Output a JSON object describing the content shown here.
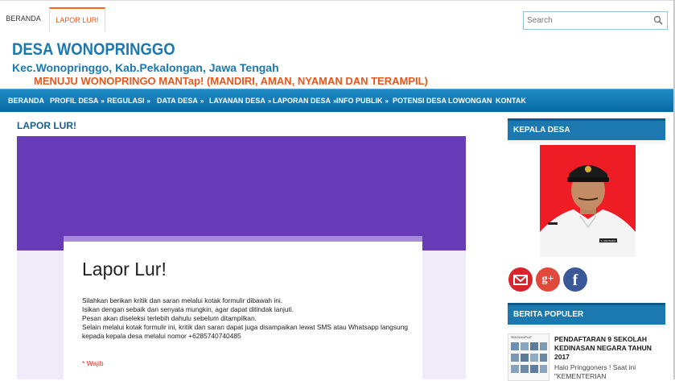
{
  "top_tabs": [
    {
      "label": "BERANDA"
    },
    {
      "label": "LAPOR LUR!"
    }
  ],
  "search": {
    "placeholder": "Search"
  },
  "site": {
    "title": "DESA WONOPRINGGO",
    "subtitle": "Kec.Wonopringgo, Kab.Pekalongan, Jawa Tengah",
    "motto": "MENUJU WONOPRINGO MANTap! (MANDIRI, AMAN, NYAMAN DAN TERAMPIL)"
  },
  "nav": [
    {
      "label": "BERANDA",
      "chevron": ""
    },
    {
      "label": "PROFIL DESA",
      "chevron": "»"
    },
    {
      "label": "REGULASI",
      "chevron": "»"
    },
    {
      "label": "DATA DESA",
      "chevron": "»"
    },
    {
      "label": "LAYANAN DESA",
      "chevron": "»"
    },
    {
      "label": "LAPORAN DESA",
      "chevron": "»"
    },
    {
      "label": "INFO PUBLIK",
      "chevron": "»"
    },
    {
      "label": "POTENSI DESA",
      "chevron": ""
    },
    {
      "label": "LOWONGAN",
      "chevron": ""
    },
    {
      "label": "KONTAK",
      "chevron": ""
    }
  ],
  "page_title": "LAPOR LUR!",
  "form": {
    "title": "Lapor Lur!",
    "lines": [
      "Silahkan berikan kritik dan saran melalui kotak formulir dibawah ini.",
      "Isikan dengan sebaik dan senyata mungkin, agar dapat ditindak lanjuti.",
      "Pesan akan diseleksi terlebih dahulu sebelum ditampilkan.",
      "Selain melalui kotak formulir ini, kritik dan saran dapat juga disampaikan lewat SMS atau Whatsapp langsung kepada kepala desa melalui nomor +6285740740485"
    ],
    "required_note": "* Wajib"
  },
  "sidebar": {
    "kepala_desa_header": "KEPALA DESA",
    "photo_nametag": "S. ANNTARIO",
    "social": {
      "gplus_glyph": "g+",
      "fb_glyph": "f"
    },
    "berita_header": "BERITA POPULER",
    "popular": {
      "thumb_label": "SEKOLAH/PLAT",
      "title": "PENDAFTARAN 9 SEKOLAH KEDINASAN NEGARA TAHUN 2017",
      "excerpt": "Halo Pringgoners ! Saat ini \"KEMENTERIAN"
    }
  },
  "colors": {
    "brand_blue": "#1b79b0",
    "accent_orange": "#e8561b",
    "form_purple": "#673ab7"
  }
}
